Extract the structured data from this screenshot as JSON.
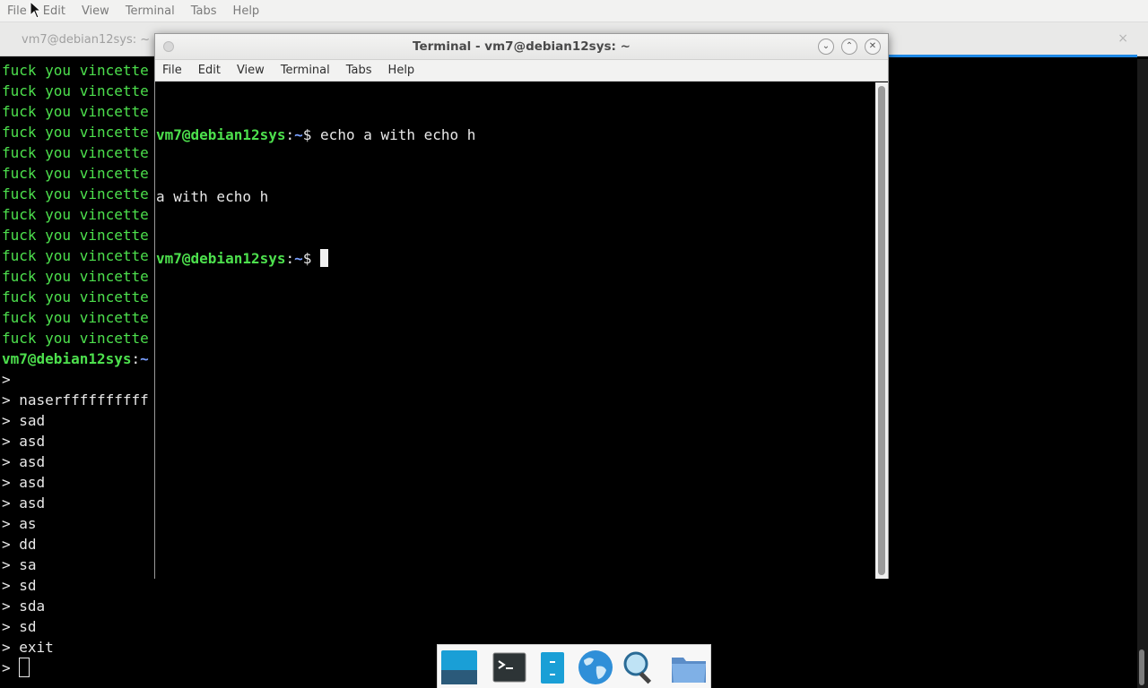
{
  "background_window": {
    "menubar": [
      "File",
      "Edit",
      "View",
      "Terminal",
      "Tabs",
      "Help"
    ],
    "tab_title": "vm7@debian12sys: ~",
    "tab_close": "×",
    "repeated_line": "fuck you vincette",
    "repeated_count": 14,
    "prompt_user": "vm7@debian12sys",
    "prompt_colon": ":",
    "prompt_path": "~",
    "continuation_lines": [
      "> ",
      "> naserffffffffff",
      "> sad",
      "> asd",
      "> asd",
      "> asd",
      "> asd",
      "> as",
      "> dd",
      "> sa",
      "> sd",
      "> sda",
      "> sd",
      "> exit"
    ],
    "last_prompt": "> "
  },
  "foreground_window": {
    "title": "Terminal - vm7@debian12sys: ~",
    "menubar": [
      "File",
      "Edit",
      "View",
      "Terminal",
      "Tabs",
      "Help"
    ],
    "controls": {
      "minimize": "⌄",
      "maximize": "⌃",
      "close": "✕"
    },
    "lines": [
      {
        "user": "vm7@debian12sys",
        "colon": ":",
        "path": "~",
        "dollar": "$ ",
        "command": "echo a with echo h"
      },
      {
        "output": "a with echo h"
      },
      {
        "user": "vm7@debian12sys",
        "colon": ":",
        "path": "~",
        "dollar": "$ ",
        "command": ""
      }
    ]
  },
  "dock": {
    "items": [
      "desktop-icon",
      "terminal-icon",
      "file-manager-icon",
      "web-browser-icon",
      "app-finder-icon",
      "folder-icon"
    ]
  },
  "colors": {
    "prompt_green": "#4de04d",
    "path_blue": "#7aa0ff",
    "accent_blue": "#1e88e5"
  }
}
